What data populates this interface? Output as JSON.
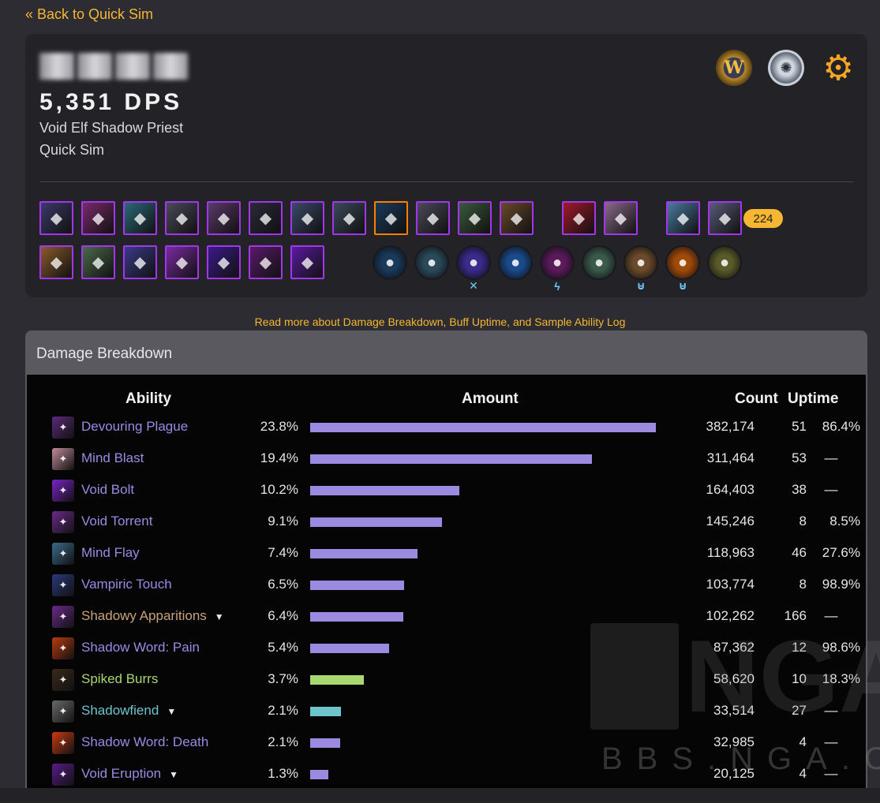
{
  "nav": {
    "back_label": "« Back to Quick Sim"
  },
  "header": {
    "dps": "5,351 DPS",
    "spec": "Void Elf Shadow Priest",
    "sim_type": "Quick Sim",
    "item_level": "224"
  },
  "readmore": "Read more about Damage Breakdown, Buff Uptime, and Sample Ability Log",
  "damage_breakdown": {
    "title": "Damage Breakdown",
    "headers": {
      "ability": "Ability",
      "amount": "Amount",
      "count": "Count",
      "uptime": "Uptime"
    },
    "rows": [
      {
        "name": "Devouring Plague",
        "pct": "23.8%",
        "fraction": 1.0,
        "amount": "382,174",
        "count": "51",
        "uptime": "86.4%",
        "color": "#9b8ae0",
        "bar_color": "#9b8ae0",
        "icon_bg": "#5b2a7a",
        "expand": false
      },
      {
        "name": "Mind Blast",
        "pct": "19.4%",
        "fraction": 0.815,
        "amount": "311,464",
        "count": "53",
        "uptime": "—",
        "color": "#9b8ae0",
        "bar_color": "#9b8ae0",
        "icon_bg": "#c08a9a",
        "expand": false
      },
      {
        "name": "Void Bolt",
        "pct": "10.2%",
        "fraction": 0.432,
        "amount": "164,403",
        "count": "38",
        "uptime": "—",
        "color": "#9b8ae0",
        "bar_color": "#9b8ae0",
        "icon_bg": "#7a22c8",
        "expand": false
      },
      {
        "name": "Void Torrent",
        "pct": "9.1%",
        "fraction": 0.381,
        "amount": "145,246",
        "count": "8",
        "uptime": "8.5%",
        "color": "#9b8ae0",
        "bar_color": "#9b8ae0",
        "icon_bg": "#6b2a8a",
        "expand": false
      },
      {
        "name": "Mind Flay",
        "pct": "7.4%",
        "fraction": 0.311,
        "amount": "118,963",
        "count": "46",
        "uptime": "27.6%",
        "color": "#9b8ae0",
        "bar_color": "#9b8ae0",
        "icon_bg": "#3a6a8a",
        "expand": false
      },
      {
        "name": "Vampiric Touch",
        "pct": "6.5%",
        "fraction": 0.272,
        "amount": "103,774",
        "count": "8",
        "uptime": "98.9%",
        "color": "#9b8ae0",
        "bar_color": "#9b8ae0",
        "icon_bg": "#2a3a7a",
        "expand": false
      },
      {
        "name": "Shadowy Apparitions",
        "pct": "6.4%",
        "fraction": 0.27,
        "amount": "102,262",
        "count": "166",
        "uptime": "—",
        "color": "#c9a27a",
        "bar_color": "#9b8ae0",
        "icon_bg": "#6a2a8a",
        "expand": true
      },
      {
        "name": "Shadow Word: Pain",
        "pct": "5.4%",
        "fraction": 0.229,
        "amount": "87,362",
        "count": "12",
        "uptime": "98.6%",
        "color": "#9b8ae0",
        "bar_color": "#9b8ae0",
        "icon_bg": "#b83a10",
        "expand": false
      },
      {
        "name": "Spiked Burrs",
        "pct": "3.7%",
        "fraction": 0.155,
        "amount": "58,620",
        "count": "10",
        "uptime": "18.3%",
        "color": "#a8d870",
        "bar_color": "#a8d870",
        "icon_bg": "#3a2a1a",
        "expand": false
      },
      {
        "name": "Shadowfiend",
        "pct": "2.1%",
        "fraction": 0.089,
        "amount": "33,514",
        "count": "27",
        "uptime": "—",
        "color": "#6ec4cc",
        "bar_color": "#6ec4cc",
        "icon_bg": "#6a6a6a",
        "expand": true
      },
      {
        "name": "Shadow Word: Death",
        "pct": "2.1%",
        "fraction": 0.086,
        "amount": "32,985",
        "count": "4",
        "uptime": "—",
        "color": "#9b8ae0",
        "bar_color": "#9b8ae0",
        "icon_bg": "#c83a10",
        "expand": false
      },
      {
        "name": "Void Eruption",
        "pct": "1.3%",
        "fraction": 0.053,
        "amount": "20,125",
        "count": "4",
        "uptime": "—",
        "color": "#9b8ae0",
        "bar_color": "#9b8ae0",
        "icon_bg": "#5a1a8a",
        "expand": true
      }
    ]
  },
  "gear_row1": [
    {
      "icon": "hood-icon",
      "bg": "#3a3a6a",
      "quality": "epic"
    },
    {
      "icon": "neck-icon",
      "bg": "#7a2a6a",
      "quality": "epic"
    },
    {
      "icon": "shoulder-icon",
      "bg": "#2a6a7a",
      "quality": "epic"
    },
    {
      "icon": "cloak-icon",
      "bg": "#4a4a5a",
      "quality": "epic"
    },
    {
      "icon": "chest-icon",
      "bg": "#5a3a6a",
      "quality": "epic"
    },
    {
      "icon": "bracers-icon",
      "bg": "#2a2a3a",
      "quality": "epic"
    },
    {
      "icon": "gloves-icon",
      "bg": "#3a4a6a",
      "quality": "epic"
    },
    {
      "icon": "belt-icon",
      "bg": "#3a4a5a",
      "quality": "epic"
    },
    {
      "icon": "legs-icon",
      "bg": "#1a3a5a",
      "quality": "legendary"
    },
    {
      "icon": "boots-icon",
      "bg": "#4a4a5a",
      "quality": "epic"
    },
    {
      "icon": "ring-icon",
      "bg": "#3a5a3a",
      "quality": "epic"
    },
    {
      "icon": "ring2-icon",
      "bg": "#6a4a2a",
      "quality": "epic"
    },
    {
      "icon": "trinket-icon",
      "bg": "#a01a2a",
      "quality": "epic"
    },
    {
      "icon": "trinket2-icon",
      "bg": "#8a6a8a",
      "quality": "epic"
    },
    {
      "icon": "weapon-icon",
      "bg": "#4a7aa0",
      "quality": "epic"
    },
    {
      "icon": "offhand-icon",
      "bg": "#5a5a7a",
      "quality": "epic"
    }
  ],
  "gear_row2": [
    {
      "icon": "soulbind-icon",
      "bg": "#8a5a2a",
      "quality": "epic"
    },
    {
      "icon": "conduit-icon",
      "bg": "#4a6a4a",
      "quality": "epic"
    },
    {
      "icon": "orb-icon",
      "bg": "#3a3a8a",
      "quality": "epic"
    },
    {
      "icon": "flame-icon",
      "bg": "#7a2aa0",
      "quality": "epic"
    },
    {
      "icon": "void-icon",
      "bg": "#3a1a8a",
      "quality": "epic"
    },
    {
      "icon": "claw-icon",
      "bg": "#5a1a6a",
      "quality": "epic"
    },
    {
      "icon": "bolt-icon",
      "bg": "#5a1aa0",
      "quality": "epic"
    }
  ],
  "talents": [
    {
      "icon": "swirl-icon",
      "bg": "#1a3a5a",
      "badge": ""
    },
    {
      "icon": "leaf-icon",
      "bg": "#2a4a5a",
      "badge": ""
    },
    {
      "icon": "shadow-icon",
      "bg": "#3a2a8a",
      "badge": "✕"
    },
    {
      "icon": "wolf-icon",
      "bg": "#1a4a8a",
      "badge": ""
    },
    {
      "icon": "eye-icon",
      "bg": "#5a1a5a",
      "badge": "ϟ"
    },
    {
      "icon": "claws-icon",
      "bg": "#3a5a4a",
      "badge": ""
    },
    {
      "icon": "face-icon",
      "bg": "#6a4a2a",
      "badge": "⊎"
    },
    {
      "icon": "fire-icon",
      "bg": "#a04a0a",
      "badge": "⊎"
    },
    {
      "icon": "gun-icon",
      "bg": "#5a5a2a",
      "badge": ""
    }
  ]
}
